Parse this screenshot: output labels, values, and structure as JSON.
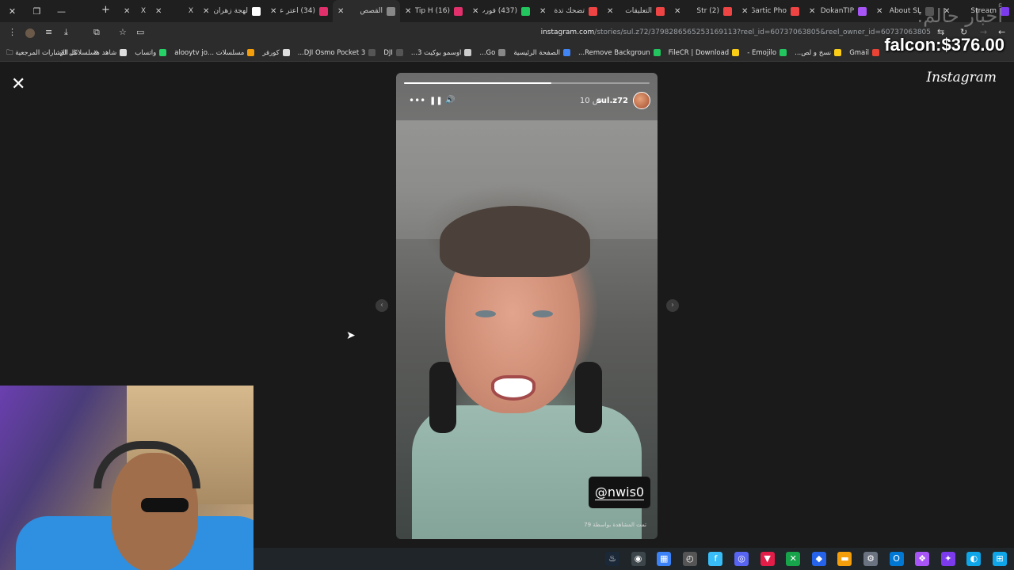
{
  "overlay": {
    "brand_text": "أخبار حالم:",
    "falcon": "falcon:$376.00"
  },
  "tabs": [
    {
      "title": "Stream",
      "color": "#7c3aed"
    },
    {
      "title": "About SL",
      "color": "#555555"
    },
    {
      "title": "DokanTIP",
      "color": "#a855f7"
    },
    {
      "title": "Gartic Pho",
      "color": "#ef4444"
    },
    {
      "title": "(2) Str",
      "color": "#ef4444"
    },
    {
      "title": "التعليقات",
      "color": "#ef4444"
    },
    {
      "title": "تضحك تدة",
      "color": "#ef4444"
    },
    {
      "title": "(437) فورت",
      "color": "#22c55e"
    },
    {
      "title": "(16) Tip H",
      "color": "#e1306c"
    },
    {
      "title": "القصص",
      "color": "#888888",
      "active": true
    },
    {
      "title": "(34) اعتر عا",
      "color": "#e1306c"
    },
    {
      "title": "لهجة زهران",
      "color": "#ffffff"
    },
    {
      "title": "X",
      "color": "#ffffff"
    },
    {
      "title": "X",
      "color": "#ffffff"
    }
  ],
  "window": {
    "close_icon": "✕",
    "restore_icon": "❐",
    "min_icon": "—",
    "new_tab": "+"
  },
  "address": {
    "domain": "instagram.com",
    "path": "/stories/sul.z72/3798286565253169113?reel_id=60737063805&reel_owner_id=60737063805"
  },
  "bookmarks": [
    {
      "label": "Gmail",
      "color": "#ea4335"
    },
    {
      "label": "نسخ و لص...",
      "color": "#facc15"
    },
    {
      "label": "Emojilo -",
      "color": "#22c55e"
    },
    {
      "label": "FileCR | Download",
      "color": "#facc15"
    },
    {
      "label": "Remove Backgroun...",
      "color": "#22c55e"
    },
    {
      "label": "الصفحة الرئيسية",
      "color": "#4285f4"
    },
    {
      "label": "Go...",
      "color": "#888888"
    },
    {
      "label": "اوسمو بوكيت 3...",
      "color": "#cccccc"
    },
    {
      "label": "DJI",
      "color": "#555555"
    },
    {
      "label": "DJI Osmo Pocket 3...",
      "color": "#555555"
    },
    {
      "label": "كورفر",
      "color": "#dddddd"
    },
    {
      "label": "مسلسلات ...alooytv jo",
      "color": "#f59e0b"
    },
    {
      "label": "واتساب",
      "color": "#25d366"
    },
    {
      "label": "شاهد مسلسلاتك الم...",
      "color": "#dddddd"
    }
  ],
  "bookmarks_all": "كل الإشارات المرجعية",
  "bookmarks_more": "»",
  "viewer": {
    "close_icon": "✕",
    "logo": "Instagram",
    "story": {
      "progress": 0.6,
      "username": "sul.z72",
      "time": "10 س",
      "tag": "@nwis0",
      "seen_by": "تمت المشاهدة بواسطة 79",
      "more_icon": "•••",
      "pause_icon": "❚❚",
      "volume_icon": "🔊"
    },
    "prev_icon": "‹",
    "next_icon": "›"
  },
  "taskbar": [
    {
      "name": "steam",
      "glyph": "♨",
      "color": "#1b2838"
    },
    {
      "name": "chrome",
      "glyph": "◉",
      "color": "#4285f4",
      "active": true
    },
    {
      "name": "store",
      "glyph": "▦",
      "color": "#3b82f6"
    },
    {
      "name": "clock",
      "glyph": "◴",
      "color": "#555555"
    },
    {
      "name": "files",
      "glyph": "f",
      "color": "#38bdf8"
    },
    {
      "name": "discord",
      "glyph": "◎",
      "color": "#5865f2"
    },
    {
      "name": "app-red",
      "glyph": "▼",
      "color": "#e11d48"
    },
    {
      "name": "xbox",
      "glyph": "✕",
      "color": "#16a34a"
    },
    {
      "name": "app-blue",
      "glyph": "◆",
      "color": "#2563eb"
    },
    {
      "name": "folder",
      "glyph": "▬",
      "color": "#f59e0b"
    },
    {
      "name": "settings",
      "glyph": "⚙",
      "color": "#6b7280"
    },
    {
      "name": "outlook",
      "glyph": "O",
      "color": "#0078d4"
    },
    {
      "name": "app-multi",
      "glyph": "❖",
      "color": "#a855f7"
    },
    {
      "name": "copilot",
      "glyph": "✦",
      "color": "#7c3aed"
    },
    {
      "name": "edge",
      "glyph": "◐",
      "color": "#0ea5e9"
    },
    {
      "name": "windows",
      "glyph": "⊞",
      "color": "#0ea5e9"
    }
  ]
}
